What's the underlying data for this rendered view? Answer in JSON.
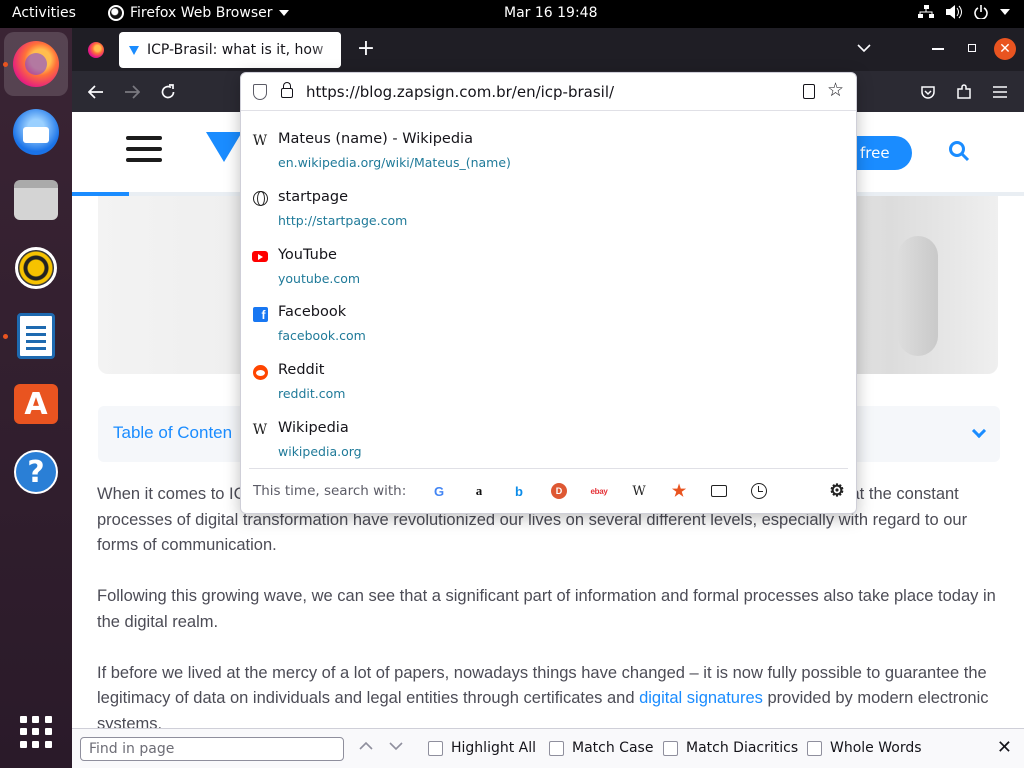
{
  "topbar": {
    "activities": "Activities",
    "app_name": "Firefox Web Browser",
    "clock": "Mar 16  19:48"
  },
  "dock": {
    "items": [
      {
        "name": "firefox",
        "active": true
      },
      {
        "name": "thunderbird"
      },
      {
        "name": "files"
      },
      {
        "name": "rhythmbox"
      },
      {
        "name": "libreoffice-writer",
        "running": true
      },
      {
        "name": "ubuntu-software"
      },
      {
        "name": "help"
      },
      {
        "name": "show-applications"
      }
    ]
  },
  "browser": {
    "tab_title": "ICP-Brasil: what is it, how",
    "url": "https://blog.zapsign.com.br/en/icp-brasil/"
  },
  "url_suggestions": [
    {
      "icon": "wikipedia-icon",
      "title": "Mateus (name) - Wikipedia",
      "url": "en.wikipedia.org/wiki/Mateus_(name)"
    },
    {
      "icon": "globe-icon",
      "title": "startpage",
      "url": "http://startpage.com"
    },
    {
      "icon": "youtube-icon",
      "title": "YouTube",
      "url": "youtube.com"
    },
    {
      "icon": "facebook-icon",
      "title": "Facebook",
      "url": "facebook.com"
    },
    {
      "icon": "reddit-icon",
      "title": "Reddit",
      "url": "reddit.com"
    },
    {
      "icon": "wikipedia-icon",
      "title": "Wikipedia",
      "url": "wikipedia.org"
    }
  ],
  "one_off": {
    "label": "This time, search with:",
    "engines": [
      "google",
      "amazon",
      "bing",
      "duckduckgo",
      "ebay",
      "wikipedia",
      "bookmarks",
      "tabs",
      "history"
    ]
  },
  "page": {
    "trial_button": "free",
    "toc_title": "Table of Conten",
    "reading_progress": 0.06,
    "para1_start": "When it comes to IC",
    "para1_end": "zed that the",
    "para1_rest": "constant processes of digital transformation have revolutionized our lives on several different levels, especially with regard to our forms of communication.",
    "para2": "Following this growing wave, we can see that a significant part of information and formal processes also take place today in the digital realm.",
    "para3_a": "If before we lived at the mercy of a lot of papers, nowadays things have changed – it is now fully possible to guarantee the legitimacy of data on individuals and legal entities through certificates and ",
    "para3_link": "digital signatures",
    "para3_b": " provided by modern electronic systems."
  },
  "findbar": {
    "placeholder": "Find in page",
    "highlight_all": "Highlight All",
    "match_case": "Match Case",
    "match_diacritics": "Match Diacritics",
    "whole_words": "Whole Words"
  },
  "colors": {
    "accent": "#1a8cff",
    "ubuntu_orange": "#e95420",
    "link": "#1f7a99"
  }
}
